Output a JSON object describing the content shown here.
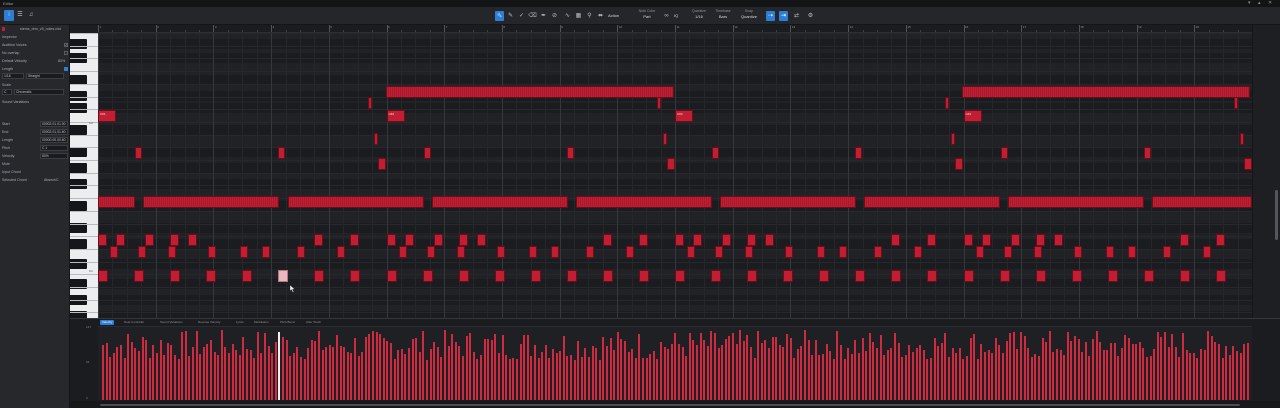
{
  "window": {
    "title": "Editor"
  },
  "toolbar": {
    "action_label": "Action",
    "note_color": {
      "label": "Note Color",
      "value": "Part"
    },
    "quantize": {
      "label": "Quantize",
      "value": "1/16"
    },
    "timebase": {
      "label": "Timebase",
      "value": "Bars"
    },
    "snap": {
      "label": "Snap",
      "value": "Quantize"
    },
    "iq_label": "IQ"
  },
  "inspector": {
    "part_name": "stems_drm_v5_notes.mid",
    "inspector_label": "Inspector",
    "audition_voices": "Audition Voices",
    "no_overlap": "No overlap",
    "default_velocity": {
      "label": "Default Velocity",
      "value": "80%"
    },
    "length": {
      "label": "Length",
      "value": "1/16"
    },
    "length_mode": "Straight",
    "scale_label": "Scale",
    "scale_root": "C",
    "scale_type": "Chromatic",
    "sound_variations": "Sound Variations",
    "start": {
      "label": "Start",
      "value": "00002.01.01.00"
    },
    "end": {
      "label": "End",
      "value": "00002.01.01.60"
    },
    "note_length": {
      "label": "Length",
      "value": "00000.00.00.60"
    },
    "pitch": {
      "label": "Pitch",
      "value": "C 1"
    },
    "velocity": {
      "label": "Velocity",
      "value": "80%"
    },
    "mute_label": "Mute",
    "input_chord_label": "Input Chord",
    "selected_chord": {
      "label": "Selected Chord",
      "value": "Absent/C"
    }
  },
  "ruler": {
    "bars": [
      "1",
      "2",
      "3",
      "4",
      "5",
      "6",
      "7",
      "8",
      "9",
      "10",
      "11",
      "12",
      "13",
      "14",
      "15",
      "16",
      "17",
      "18",
      "19",
      "20",
      "21"
    ]
  },
  "keyboard": {
    "labels": [
      "C2",
      "C1"
    ]
  },
  "note_labels": [
    "C#1",
    "C#2",
    "C#3",
    "C#4"
  ],
  "editor_tabs": [
    "Velocity",
    "Note Controller",
    "Sound Variations",
    "Reverse Velocity",
    "Lyrics",
    "Modulation",
    "Pitch Bend",
    "After Touch"
  ],
  "velocity_lane": {
    "top_label": "127",
    "mid_label": "64",
    "bottom_label": "0"
  },
  "colors": {
    "note": "#c01e33",
    "accent": "#2d7fd6",
    "background": "#202226"
  }
}
